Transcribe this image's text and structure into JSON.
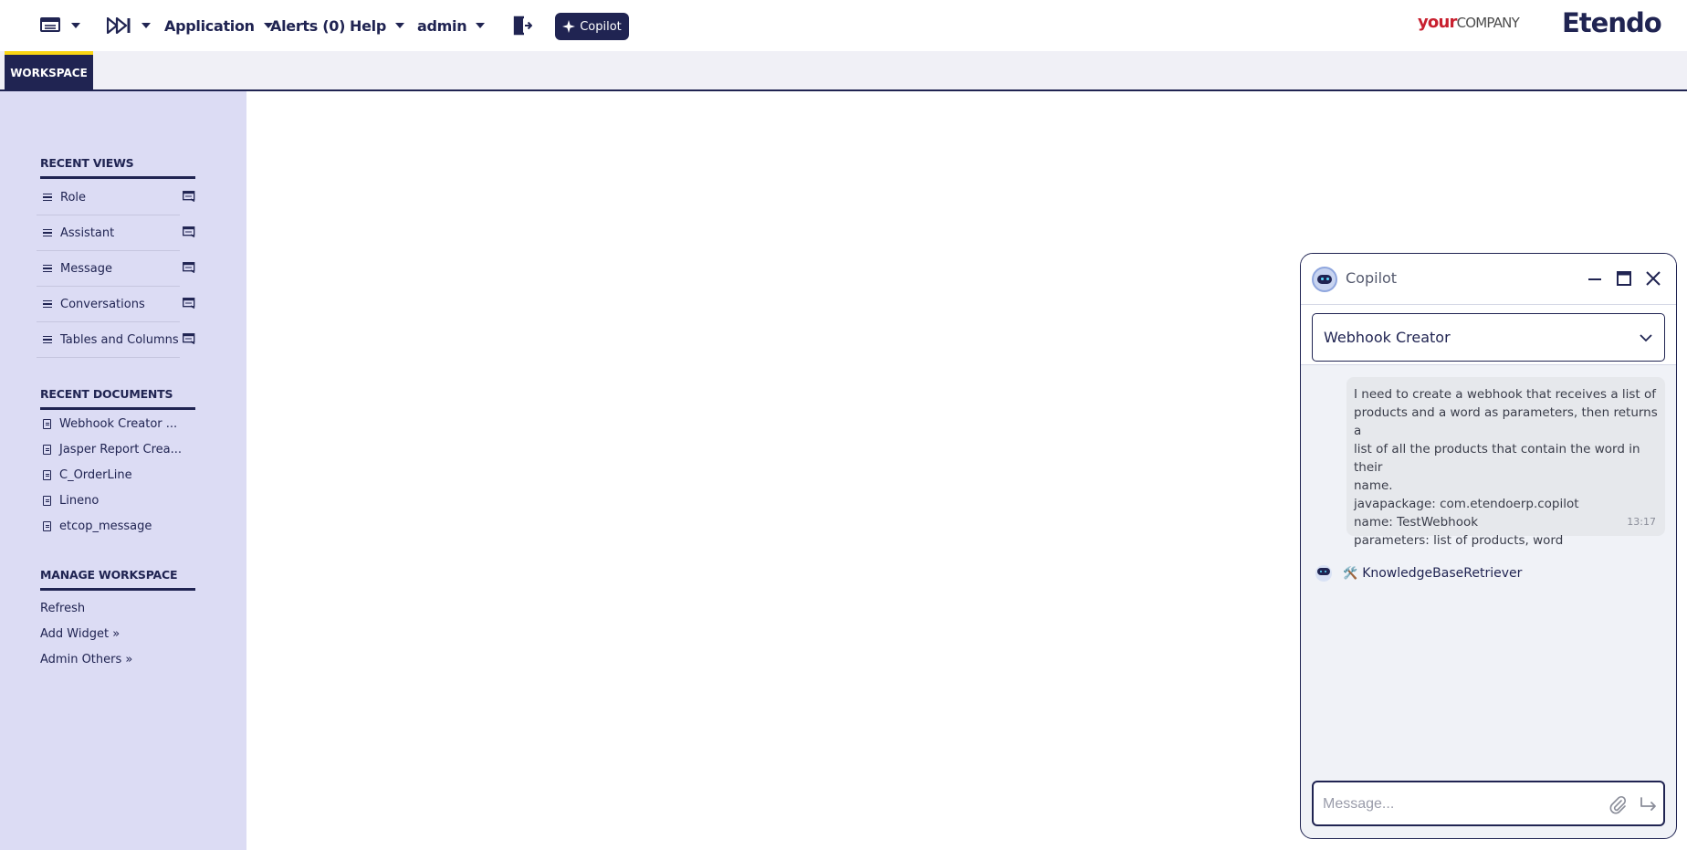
{
  "topbar": {
    "menu_icon": "list-menu-icon",
    "quick_launch_icon": "fast-forward-icon",
    "application": "Application",
    "alerts": "Alerts (0)",
    "help": "Help",
    "user": "admin",
    "logout_icon": "logout-icon",
    "copilot_button": "Copilot",
    "logo_your": "your",
    "logo_company": "COMPANY",
    "logo_brand": "Etendo"
  },
  "tabs": {
    "workspace": "WORKSPACE"
  },
  "sidebar": {
    "recent_views_title": "RECENT VIEWS",
    "recent_views": [
      "Role",
      "Assistant",
      "Message",
      "Conversations",
      "Tables and Columns"
    ],
    "recent_documents_title": "RECENT DOCUMENTS",
    "recent_documents": [
      "Webhook Creator ...",
      "Jasper Report Crea...",
      "C_OrderLine",
      "Lineno",
      "etcop_message"
    ],
    "manage_title": "MANAGE WORKSPACE",
    "manage_items": [
      "Refresh",
      "Add Widget »",
      "Admin Others »"
    ]
  },
  "copilot": {
    "title": "Copilot",
    "assistant": "Webhook Creator",
    "messages": [
      {
        "role": "user",
        "text": "I need to create a webhook that receives a list of\nproducts and a word as parameters, then returns a\nlist of all the products that contain the word in their\nname.\njavapackage: com.etendoerp.copilot\nname: TestWebhook\nparameters: list of products, word",
        "time": "13:17"
      }
    ],
    "tool_emoji": "🛠️",
    "tool_name": "KnowledgeBaseRetriever",
    "input_placeholder": "Message...",
    "input_value": ""
  },
  "colors": {
    "primary": "#202452",
    "sidebar_bg": "#dcdcf4",
    "accent_yellow": "#fad614",
    "logo_red": "#c8202f"
  }
}
